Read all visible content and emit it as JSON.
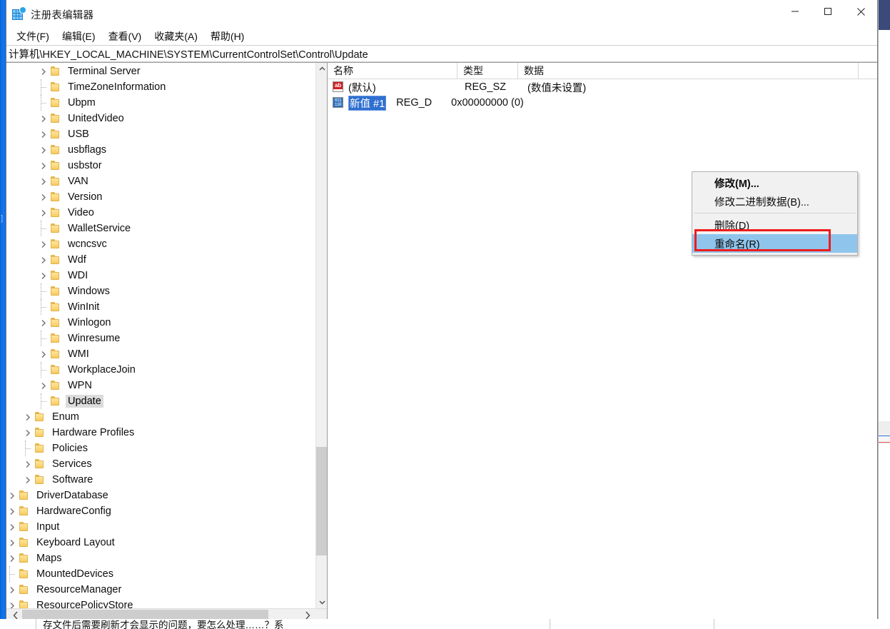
{
  "window": {
    "title": "注册表编辑器",
    "icon": "registry-editor-icon",
    "controls": {
      "minimize": "minimize-icon",
      "maximize": "maximize-icon",
      "close": "close-icon"
    }
  },
  "menubar": {
    "items": [
      {
        "label": "文件(F)"
      },
      {
        "label": "编辑(E)"
      },
      {
        "label": "查看(V)"
      },
      {
        "label": "收藏夹(A)"
      },
      {
        "label": "帮助(H)"
      }
    ]
  },
  "address": {
    "path": "计算机\\HKEY_LOCAL_MACHINE\\SYSTEM\\CurrentControlSet\\Control\\Update"
  },
  "tree": {
    "items": [
      {
        "label": "Terminal Server",
        "indent": 3,
        "expander": "collapsed",
        "selected": false
      },
      {
        "label": "TimeZoneInformation",
        "indent": 3,
        "expander": "none",
        "selected": false
      },
      {
        "label": "Ubpm",
        "indent": 3,
        "expander": "none",
        "selected": false
      },
      {
        "label": "UnitedVideo",
        "indent": 3,
        "expander": "collapsed",
        "selected": false
      },
      {
        "label": "USB",
        "indent": 3,
        "expander": "collapsed",
        "selected": false
      },
      {
        "label": "usbflags",
        "indent": 3,
        "expander": "collapsed",
        "selected": false
      },
      {
        "label": "usbstor",
        "indent": 3,
        "expander": "collapsed",
        "selected": false
      },
      {
        "label": "VAN",
        "indent": 3,
        "expander": "collapsed",
        "selected": false
      },
      {
        "label": "Version",
        "indent": 3,
        "expander": "collapsed",
        "selected": false
      },
      {
        "label": "Video",
        "indent": 3,
        "expander": "collapsed",
        "selected": false
      },
      {
        "label": "WalletService",
        "indent": 3,
        "expander": "none",
        "selected": false
      },
      {
        "label": "wcncsvc",
        "indent": 3,
        "expander": "collapsed",
        "selected": false
      },
      {
        "label": "Wdf",
        "indent": 3,
        "expander": "collapsed",
        "selected": false
      },
      {
        "label": "WDI",
        "indent": 3,
        "expander": "collapsed",
        "selected": false
      },
      {
        "label": "Windows",
        "indent": 3,
        "expander": "none",
        "selected": false
      },
      {
        "label": "WinInit",
        "indent": 3,
        "expander": "none",
        "selected": false
      },
      {
        "label": "Winlogon",
        "indent": 3,
        "expander": "collapsed",
        "selected": false
      },
      {
        "label": "Winresume",
        "indent": 3,
        "expander": "none",
        "selected": false
      },
      {
        "label": "WMI",
        "indent": 3,
        "expander": "collapsed",
        "selected": false
      },
      {
        "label": "WorkplaceJoin",
        "indent": 3,
        "expander": "none",
        "selected": false
      },
      {
        "label": "WPN",
        "indent": 3,
        "expander": "collapsed",
        "selected": false
      },
      {
        "label": "Update",
        "indent": 3,
        "expander": "none",
        "selected": true
      },
      {
        "label": "Enum",
        "indent": 2,
        "expander": "collapsed",
        "selected": false
      },
      {
        "label": "Hardware Profiles",
        "indent": 2,
        "expander": "collapsed",
        "selected": false
      },
      {
        "label": "Policies",
        "indent": 2,
        "expander": "none",
        "selected": false
      },
      {
        "label": "Services",
        "indent": 2,
        "expander": "collapsed",
        "selected": false
      },
      {
        "label": "Software",
        "indent": 2,
        "expander": "collapsed",
        "selected": false
      },
      {
        "label": "DriverDatabase",
        "indent": 1,
        "expander": "collapsed",
        "selected": false
      },
      {
        "label": "HardwareConfig",
        "indent": 1,
        "expander": "collapsed",
        "selected": false
      },
      {
        "label": "Input",
        "indent": 1,
        "expander": "collapsed",
        "selected": false
      },
      {
        "label": "Keyboard Layout",
        "indent": 1,
        "expander": "collapsed",
        "selected": false
      },
      {
        "label": "Maps",
        "indent": 1,
        "expander": "collapsed",
        "selected": false
      },
      {
        "label": "MountedDevices",
        "indent": 1,
        "expander": "none",
        "selected": false
      },
      {
        "label": "ResourceManager",
        "indent": 1,
        "expander": "collapsed",
        "selected": false
      },
      {
        "label": "ResourcePolicyStore",
        "indent": 1,
        "expander": "collapsed",
        "selected": false
      }
    ]
  },
  "value_list": {
    "columns": [
      {
        "label": "名称"
      },
      {
        "label": "类型"
      },
      {
        "label": "数据"
      }
    ],
    "rows": [
      {
        "icon": "string-value-icon",
        "name": "(默认)",
        "type": "REG_SZ",
        "data": "(数值未设置)",
        "selected": false
      },
      {
        "icon": "dword-value-icon",
        "name": "新值 #1",
        "type": "REG_D",
        "data": "0x00000000 (0)",
        "selected": true
      }
    ]
  },
  "context_menu": {
    "items": [
      {
        "label": "修改(M)...",
        "bold": true,
        "highlighted": false,
        "separator_after": false
      },
      {
        "label": "修改二进制数据(B)...",
        "bold": false,
        "highlighted": false,
        "separator_after": true
      },
      {
        "label": "删除(D)",
        "bold": false,
        "highlighted": false,
        "separator_after": false
      },
      {
        "label": "重命名(R)",
        "bold": false,
        "highlighted": true,
        "separator_after": false
      }
    ],
    "highlight_color": "#ee1c1c"
  },
  "status": {
    "text": "存文件后需要刷新才会显示的问题，要怎么处理……？系"
  },
  "colors": {
    "selection_blue": "#2f6fd0",
    "menu_highlight": "#8fc5ec",
    "annotation_red": "#ee1c1c",
    "folder_yellow": "#fcd87c",
    "tree_selected_gray": "#dcdcdc"
  }
}
